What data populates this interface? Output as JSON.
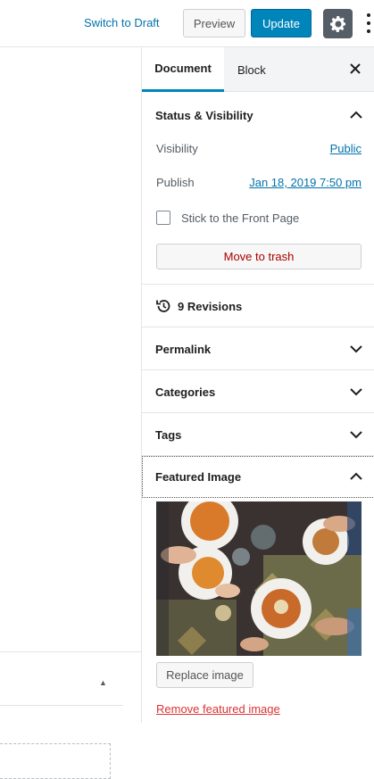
{
  "header": {
    "switch_draft": "Switch to Draft",
    "preview": "Preview",
    "update": "Update",
    "settings_icon": "gear-icon",
    "more_icon": "more-vertical-icon"
  },
  "sidebar": {
    "tabs": [
      {
        "label": "Document",
        "active": true
      },
      {
        "label": "Block",
        "active": false
      }
    ],
    "close_icon": "close-icon",
    "status_visibility": {
      "title": "Status & Visibility",
      "expanded": true,
      "visibility_label": "Visibility",
      "visibility_value": "Public",
      "publish_label": "Publish",
      "publish_value": "Jan 18, 2019 7:50 pm",
      "sticky_label": "Stick to the Front Page",
      "sticky_checked": false,
      "trash_label": "Move to trash"
    },
    "revisions": {
      "label": "9 Revisions",
      "icon": "history-icon"
    },
    "panels": [
      {
        "title": "Permalink",
        "expanded": false
      },
      {
        "title": "Categories",
        "expanded": false
      },
      {
        "title": "Tags",
        "expanded": false
      }
    ],
    "featured_image": {
      "title": "Featured Image",
      "expanded": true,
      "replace_label": "Replace image",
      "remove_label": "Remove featured image"
    }
  },
  "colors": {
    "accent": "#0085ba",
    "link": "#0073aa",
    "danger": "#a00"
  }
}
